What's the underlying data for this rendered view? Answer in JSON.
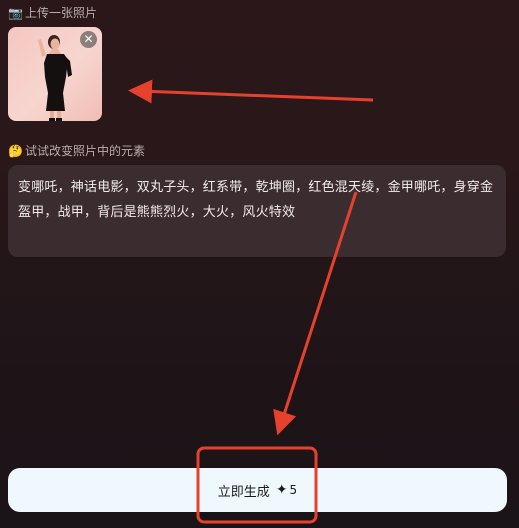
{
  "upload": {
    "icon": "camera-icon",
    "label": "上传一张照片",
    "remove_icon": "close-icon",
    "remove_glyph": "✕"
  },
  "elements": {
    "icon": "thinking-face-icon",
    "label": "试试改变照片中的元素"
  },
  "prompt": {
    "text": "变哪吒，神话电影，双丸子头，红系带，乾坤圈，红色混天绫，金甲哪吒，身穿金盔甲，战甲，背后是熊熊烈火，大火，风火特效"
  },
  "generate_button": {
    "label": "立即生成",
    "credit_icon": "sparkle-icon",
    "credit_value": "5"
  },
  "colors": {
    "annotation": "#e5412d",
    "button_bg": "#eef8fd",
    "prompt_bg": "#3a2c2f"
  }
}
